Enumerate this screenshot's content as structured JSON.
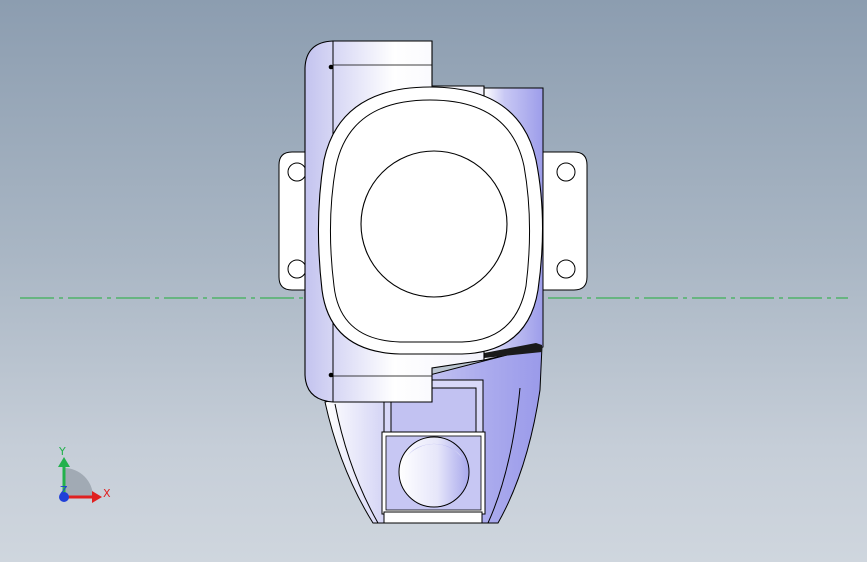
{
  "viewport": {
    "background_top": "#8c9db0",
    "background_bottom": "#cfd6de"
  },
  "triad": {
    "x_label": "X",
    "y_label": "Y",
    "z_label": "Z",
    "x_color": "#e02020",
    "y_color": "#22b14c",
    "z_color": "#1f3fd8"
  },
  "centerline": {
    "color": "#1fae3a",
    "style": "dash-dot"
  },
  "model": {
    "fill_color": "#ffffff",
    "shade_color": "#b8b8f2",
    "edge_color": "#000000"
  }
}
